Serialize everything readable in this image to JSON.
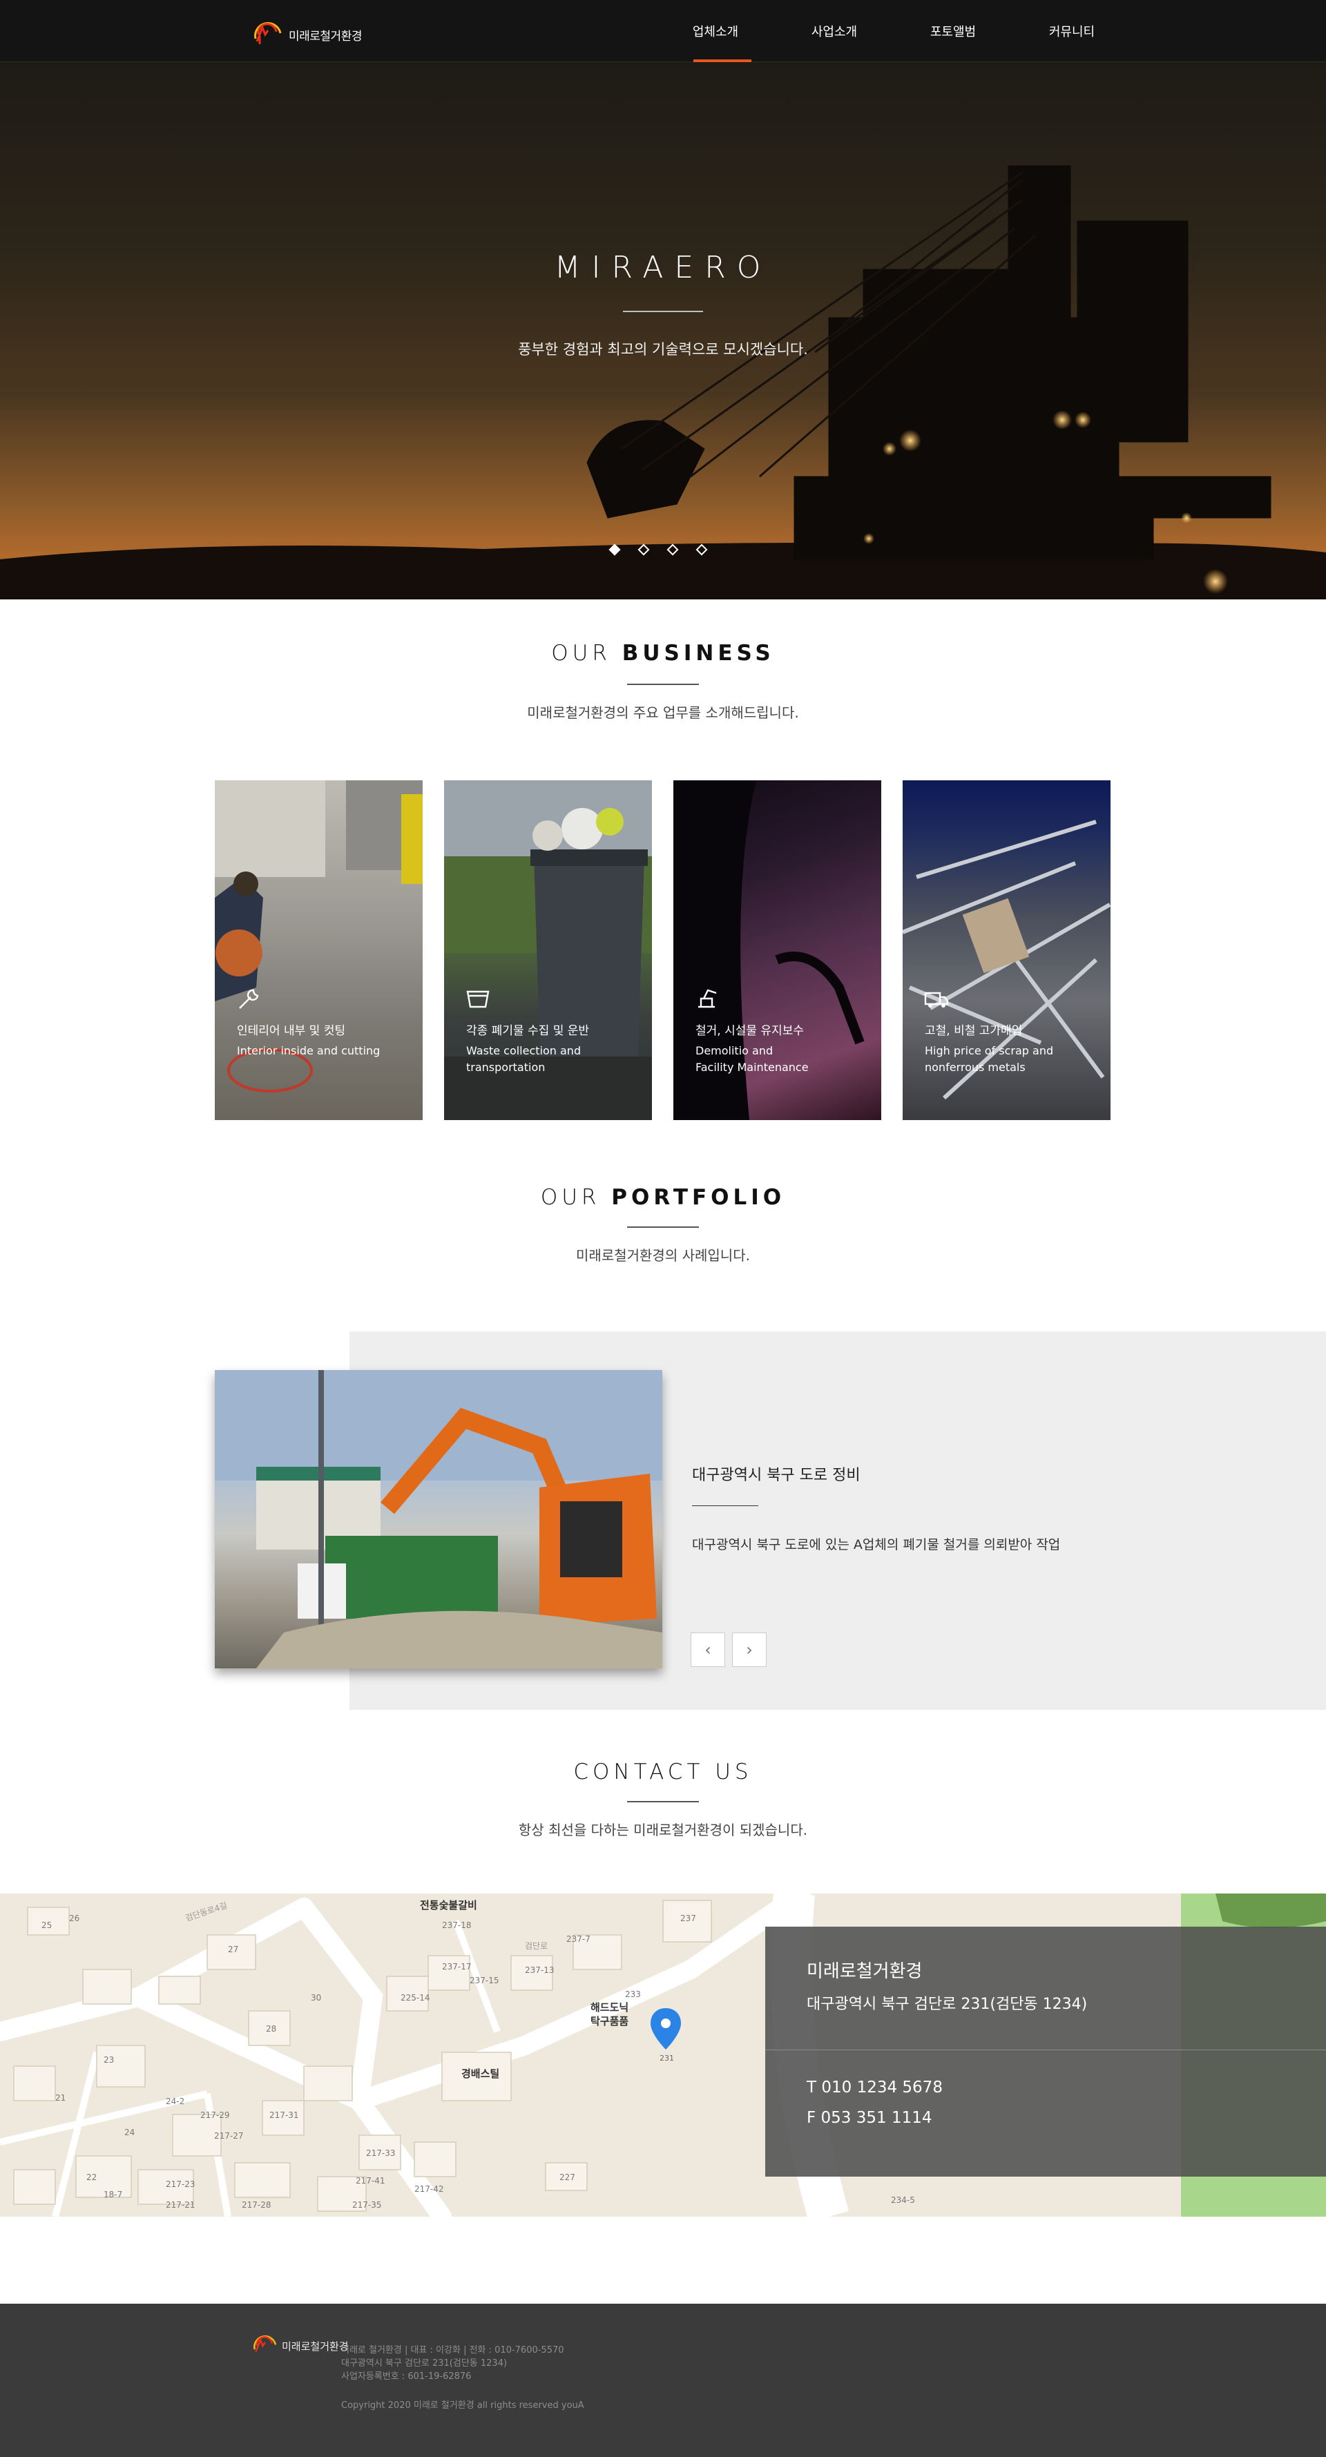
{
  "header": {
    "logo_text": "미래로철거환경",
    "nav": [
      "업체소개",
      "사업소개",
      "포토앨범",
      "커뮤니티"
    ],
    "active_index": 0
  },
  "hero": {
    "title": "MIRAERO",
    "subtitle": "풍부한 경험과 최고의 기술력으로 모시겠습니다.",
    "slide_count": 4,
    "active_slide": 1
  },
  "business": {
    "title_light": "OUR ",
    "title_bold": "BUSINESS",
    "subtitle": "미래로철거환경의 주요 업무를 소개해드립니다.",
    "cards": [
      {
        "icon": "wrench-icon",
        "ko": "인테리어 내부 및 컷팅",
        "en": "Interior inside and cutting"
      },
      {
        "icon": "bin-icon",
        "ko": "각종 폐기물 수집 및 운반",
        "en": "Waste collection and\ntransportation"
      },
      {
        "icon": "excavator-icon",
        "ko": "철거, 시설물 유지보수",
        "en": "Demolitio and\nFacility Maintenance"
      },
      {
        "icon": "truck-icon",
        "ko": "고철, 비철 고가매입",
        "en": "High price of scrap and\nnonferrous metals"
      }
    ]
  },
  "portfolio": {
    "title_light": "OUR ",
    "title_bold": "PORTFOLIO",
    "subtitle": "미래로철거환경의 사례입니다.",
    "item_title": "대구광역시 북구 도로 정비",
    "item_desc": "대구광역시 북구 도로에 있는 A업체의 폐기물 철거를 의뢰받아 작업",
    "prev_label": "‹",
    "next_label": "›"
  },
  "contact": {
    "title": "CONTACT US",
    "subtitle": "항상 최선을 다하는 미래로철거환경이 되겠습니다.",
    "name": "미래로철거환경",
    "address": "대구광역시 북구 검단로 231(검단동 1234)",
    "tel": "T 010 1234 5678",
    "fax": "F 053 351 1114"
  },
  "map": {
    "labels": [
      "전통숯불갈비",
      "해드도닉\n탁구품품",
      "경배스틸",
      "검단동로4길",
      "검단로"
    ],
    "numbers": [
      "25",
      "27",
      "26",
      "23",
      "30",
      "28",
      "225-14",
      "237-17",
      "237-15",
      "237-13",
      "233",
      "237",
      "237-7",
      "237-18",
      "217-31",
      "217-29",
      "217-27",
      "217-33",
      "217-41",
      "217-42",
      "217-35",
      "217-28",
      "217-23",
      "217-21",
      "18-7",
      "22",
      "24",
      "24-2",
      "21",
      "227",
      "234-5"
    ],
    "marker_label": "231"
  },
  "footer": {
    "logo_text": "미래로철거환경",
    "info_line1": "미래로 철거환경  |  대표 : 이강화  |  전화 : 010-7600-5570",
    "info_line2": "대구광역시 북구 검단로 231(검단동 1234)",
    "info_line3": "사업자등록번호 : 601-19-62876",
    "copyright": "Copyright 2020 미래로 철거환경 all rights reserved youA"
  },
  "colors": {
    "accent": "#e8571c",
    "header_bg": "#141414",
    "footer_bg": "#3b3b3b",
    "map_marker": "#2b83e6"
  }
}
